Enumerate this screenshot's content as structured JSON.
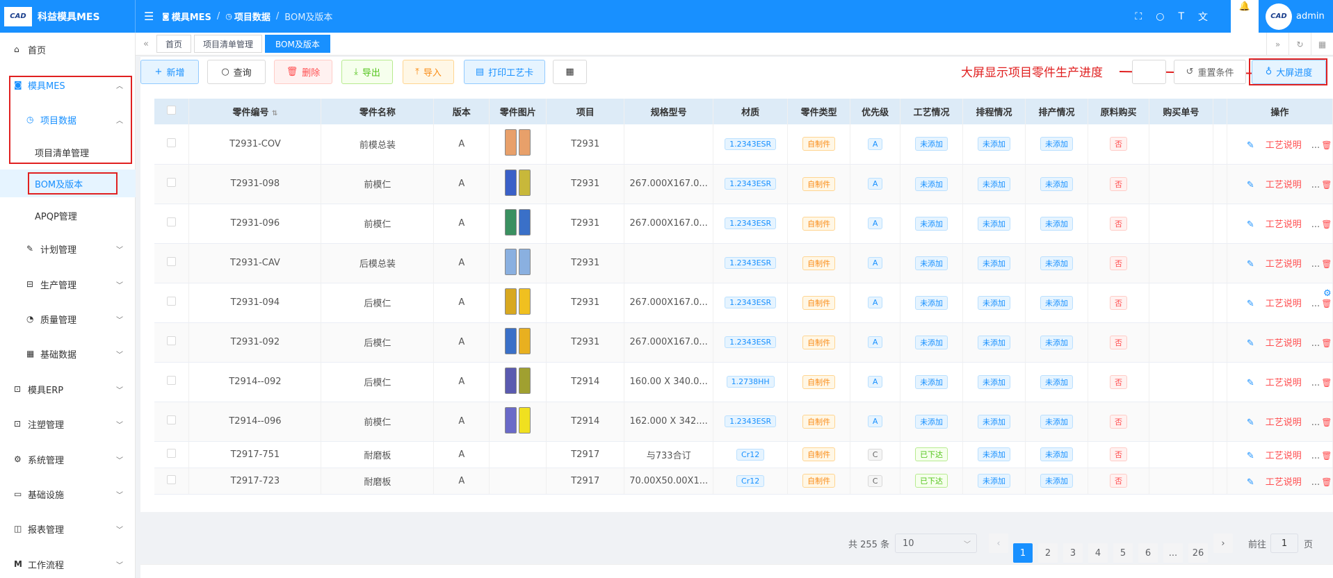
{
  "app": {
    "logo_text": "CAD",
    "title": "科益模具MES",
    "breadcrumb": [
      "模具MES",
      "项目数据",
      "BOM及版本"
    ],
    "user": "admin",
    "user_avatar_text": "CAD"
  },
  "sidebar": {
    "home": "首页",
    "items": [
      {
        "label": "模具MES",
        "icon": "camera-icon"
      },
      {
        "label": "项目数据",
        "icon": "clock-icon"
      },
      {
        "label": "项目清单管理"
      },
      {
        "label": "BOM及版本"
      },
      {
        "label": "APQP管理"
      },
      {
        "label": "计划管理",
        "icon": "edit-icon"
      },
      {
        "label": "生产管理",
        "icon": "cart-icon"
      },
      {
        "label": "质量管理",
        "icon": "timer-icon"
      },
      {
        "label": "基础数据",
        "icon": "calendar-icon"
      },
      {
        "label": "模具ERP",
        "icon": "box-icon"
      },
      {
        "label": "注塑管理",
        "icon": "box-icon"
      },
      {
        "label": "系统管理",
        "icon": "gear-icon"
      },
      {
        "label": "基础设施",
        "icon": "monitor-icon"
      },
      {
        "label": "报表管理",
        "icon": "chart-icon"
      },
      {
        "label": "工作流程",
        "icon": "flow-icon"
      }
    ]
  },
  "tags": [
    "首页",
    "项目清单管理",
    "BOM及版本"
  ],
  "toolbar": {
    "add": "新增",
    "query": "查询",
    "delete": "删除",
    "export": "导出",
    "import": "导入",
    "print": "打印工艺卡",
    "reset": "重置条件",
    "big_screen": "大屏进度"
  },
  "annotation": "大屏显示项目零件生产进度",
  "table": {
    "headers": [
      "零件编号",
      "零件名称",
      "版本",
      "零件图片",
      "项目",
      "规格型号",
      "材质",
      "零件类型",
      "优先级",
      "工艺情况",
      "排程情况",
      "排产情况",
      "原料购买",
      "购买单号",
      "",
      "操作"
    ],
    "op_labels": {
      "craft": "工艺说明",
      "more": "..."
    },
    "rows": [
      {
        "code": "T2931-COV",
        "name": "前模总装",
        "ver": "A",
        "project": "T2931",
        "spec": "",
        "material": "1.2343ESR",
        "type": "自制件",
        "priority": "A",
        "craft": "未添加",
        "sched": "未添加",
        "prod": "未添加",
        "buy": "否",
        "thumb": [
          "#e8a06a",
          "#e8a06a"
        ]
      },
      {
        "code": "T2931-098",
        "name": "前模仁",
        "ver": "A",
        "project": "T2931",
        "spec": "267.000X167.0...",
        "material": "1.2343ESR",
        "type": "自制件",
        "priority": "A",
        "craft": "未添加",
        "sched": "未添加",
        "prod": "未添加",
        "buy": "否",
        "thumb": [
          "#3a60c8",
          "#c8b83a"
        ]
      },
      {
        "code": "T2931-096",
        "name": "前模仁",
        "ver": "A",
        "project": "T2931",
        "spec": "267.000X167.0...",
        "material": "1.2343ESR",
        "type": "自制件",
        "priority": "A",
        "craft": "未添加",
        "sched": "未添加",
        "prod": "未添加",
        "buy": "否",
        "thumb": [
          "#3a9060",
          "#3a70c8"
        ]
      },
      {
        "code": "T2931-CAV",
        "name": "后模总装",
        "ver": "A",
        "project": "T2931",
        "spec": "",
        "material": "1.2343ESR",
        "type": "自制件",
        "priority": "A",
        "craft": "未添加",
        "sched": "未添加",
        "prod": "未添加",
        "buy": "否",
        "thumb": [
          "#8ab0e0",
          "#8ab0e0"
        ]
      },
      {
        "code": "T2931-094",
        "name": "后模仁",
        "ver": "A",
        "project": "T2931",
        "spec": "267.000X167.0...",
        "material": "1.2343ESR",
        "type": "自制件",
        "priority": "A",
        "craft": "未添加",
        "sched": "未添加",
        "prod": "未添加",
        "buy": "否",
        "thumb": [
          "#d8a820",
          "#f0c020"
        ]
      },
      {
        "code": "T2931-092",
        "name": "后模仁",
        "ver": "A",
        "project": "T2931",
        "spec": "267.000X167.0...",
        "material": "1.2343ESR",
        "type": "自制件",
        "priority": "A",
        "craft": "未添加",
        "sched": "未添加",
        "prod": "未添加",
        "buy": "否",
        "thumb": [
          "#3a70c8",
          "#e8b020"
        ]
      },
      {
        "code": "T2914--092",
        "name": "后模仁",
        "ver": "A",
        "project": "T2914",
        "spec": "160.00 X 340.0...",
        "material": "1.2738HH",
        "type": "自制件",
        "priority": "A",
        "craft": "未添加",
        "sched": "未添加",
        "prod": "未添加",
        "buy": "否",
        "thumb": [
          "#5a5ab0",
          "#a0a030"
        ]
      },
      {
        "code": "T2914--096",
        "name": "前模仁",
        "ver": "A",
        "project": "T2914",
        "spec": "162.000 X 342....",
        "material": "1.2343ESR",
        "type": "自制件",
        "priority": "A",
        "craft": "未添加",
        "sched": "未添加",
        "prod": "未添加",
        "buy": "否",
        "thumb": [
          "#6a6ac8",
          "#f0e020"
        ]
      },
      {
        "code": "T2917-751",
        "name": "耐磨板",
        "ver": "A",
        "project": "T2917",
        "spec": "与733合订",
        "material": "Cr12",
        "type": "自制件",
        "priority": "C",
        "craft": "已下达",
        "sched": "未添加",
        "prod": "未添加",
        "buy": "否",
        "thumb": []
      },
      {
        "code": "T2917-723",
        "name": "耐磨板",
        "ver": "A",
        "project": "T2917",
        "spec": "70.00X50.00X1...",
        "material": "Cr12",
        "type": "自制件",
        "priority": "C",
        "craft": "已下达",
        "sched": "未添加",
        "prod": "未添加",
        "buy": "否",
        "thumb": []
      }
    ]
  },
  "pagination": {
    "total": "共 255 条",
    "page_size": "10",
    "pages": [
      "1",
      "2",
      "3",
      "4",
      "5",
      "6",
      "...",
      "26"
    ],
    "current": "1",
    "jump_label": "前往",
    "jump_value": "1",
    "jump_suffix": "页"
  },
  "colors": {
    "primary": "#1890ff",
    "annotation": "#e02020"
  }
}
